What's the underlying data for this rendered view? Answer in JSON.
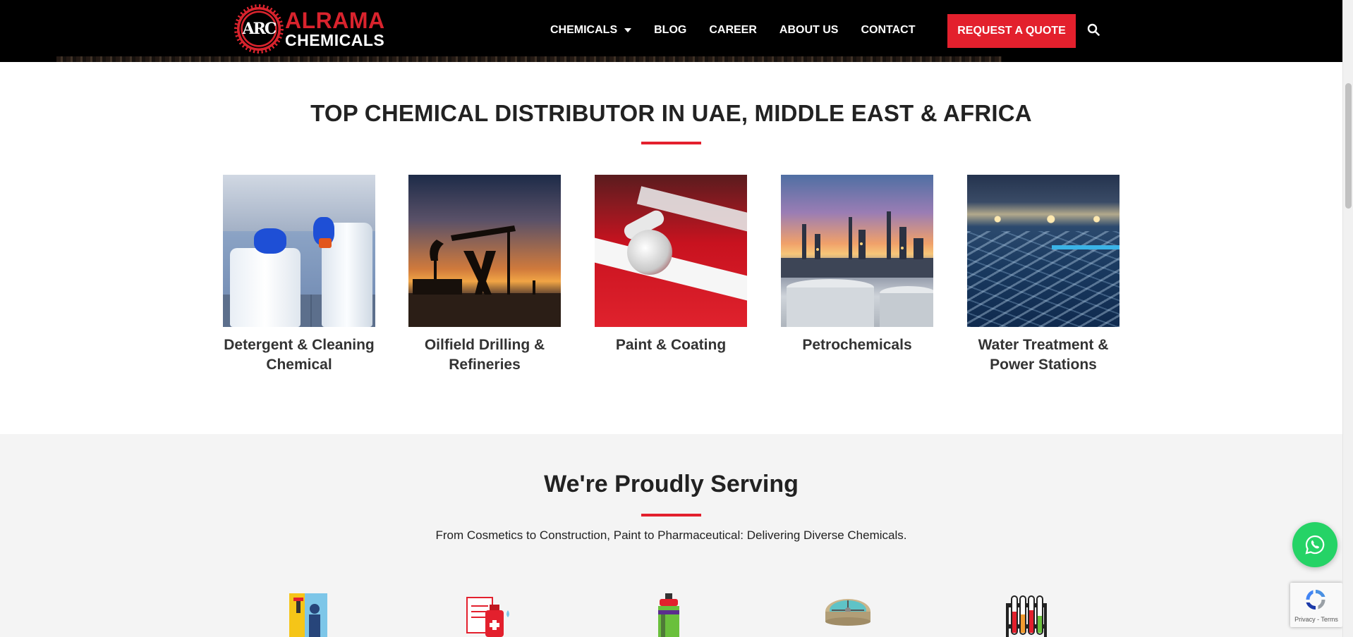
{
  "header": {
    "logo_top": "ALRAMA",
    "logo_bottom": "CHEMICALS",
    "logo_emblem": "ARC",
    "nav": [
      {
        "label": "CHEMICALS",
        "has_dropdown": true
      },
      {
        "label": "BLOG"
      },
      {
        "label": "CAREER"
      },
      {
        "label": "ABOUT US"
      },
      {
        "label": "CONTACT"
      }
    ],
    "cta_label": "REQUEST A QUOTE",
    "search_icon": "search-icon"
  },
  "distributor": {
    "title": "TOP CHEMICAL DISTRIBUTOR IN UAE, MIDDLE EAST & AFRICA",
    "cards": [
      {
        "label_line1": "Detergent & Cleaning",
        "label_line2": "Chemical"
      },
      {
        "label_line1": "Oilfield Drilling &",
        "label_line2": "Refineries"
      },
      {
        "label_line1": "Paint & Coating",
        "label_line2": ""
      },
      {
        "label_line1": "Petrochemicals",
        "label_line2": ""
      },
      {
        "label_line1": "Water Treatment &",
        "label_line2": "Power Stations"
      }
    ]
  },
  "serving": {
    "title": "We're Proudly Serving",
    "subtitle": "From Cosmetics to Construction, Paint to Pharmaceutical: Delivering Diverse Chemicals.",
    "icons": [
      "construction-painter-icon",
      "pharmaceutical-bottle-icon",
      "spray-can-icon",
      "water-clarifier-icon",
      "test-tubes-icon"
    ]
  },
  "floating": {
    "whatsapp_icon": "whatsapp-icon",
    "recaptcha_text": "Privacy - Terms"
  },
  "colors": {
    "accent": "#e3202d",
    "header_bg": "#000000",
    "section_bg": "#f4f4f4",
    "whatsapp": "#25d366"
  }
}
